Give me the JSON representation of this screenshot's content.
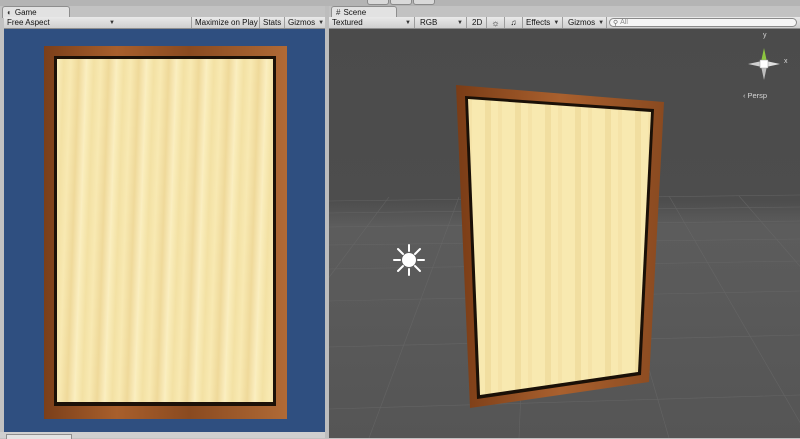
{
  "game": {
    "tab_label": "Game",
    "aspect": "Free Aspect",
    "maximize": "Maximize on Play",
    "stats": "Stats",
    "gizmos": "Gizmos"
  },
  "scene": {
    "tab_label": "Scene",
    "shading": "Textured",
    "color_mode": "RGB",
    "mode_2d": "2D",
    "effects": "Effects",
    "gizmos": "Gizmos",
    "search_placeholder": "All",
    "gizmo_x": "x",
    "gizmo_y": "y",
    "persp": "Persp"
  },
  "colors": {
    "game_background": "#2f4f80",
    "scene_background": "#4d4d4d",
    "wood_frame": "#9a5428",
    "wood_panel": "#f7e7ae"
  },
  "icons": [
    "game-tab-icon",
    "scene-tab-icon",
    "sun-toggle-icon",
    "audio-toggle-icon",
    "search-icon",
    "scene-gizmo-icon",
    "directional-light-icon"
  ]
}
